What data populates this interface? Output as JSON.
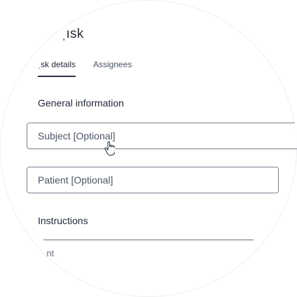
{
  "header": {
    "title": "ˌısk"
  },
  "tabs": [
    {
      "label": "ˌsk details",
      "active": true
    },
    {
      "label": "Assignees",
      "active": false
    }
  ],
  "sections": {
    "general": {
      "title": "General information",
      "subject_placeholder": "Subject [Optional]",
      "patient_placeholder": "Patient [Optional]"
    },
    "instructions": {
      "title": "Instructions",
      "partial_field_label": "ˌnt"
    }
  },
  "cursor": {
    "icon": "hand-pointer-icon"
  },
  "colors": {
    "text": "#1f2937",
    "muted": "#4b5563",
    "border": "#7b8190",
    "tab_indicator": "#2f3744"
  }
}
